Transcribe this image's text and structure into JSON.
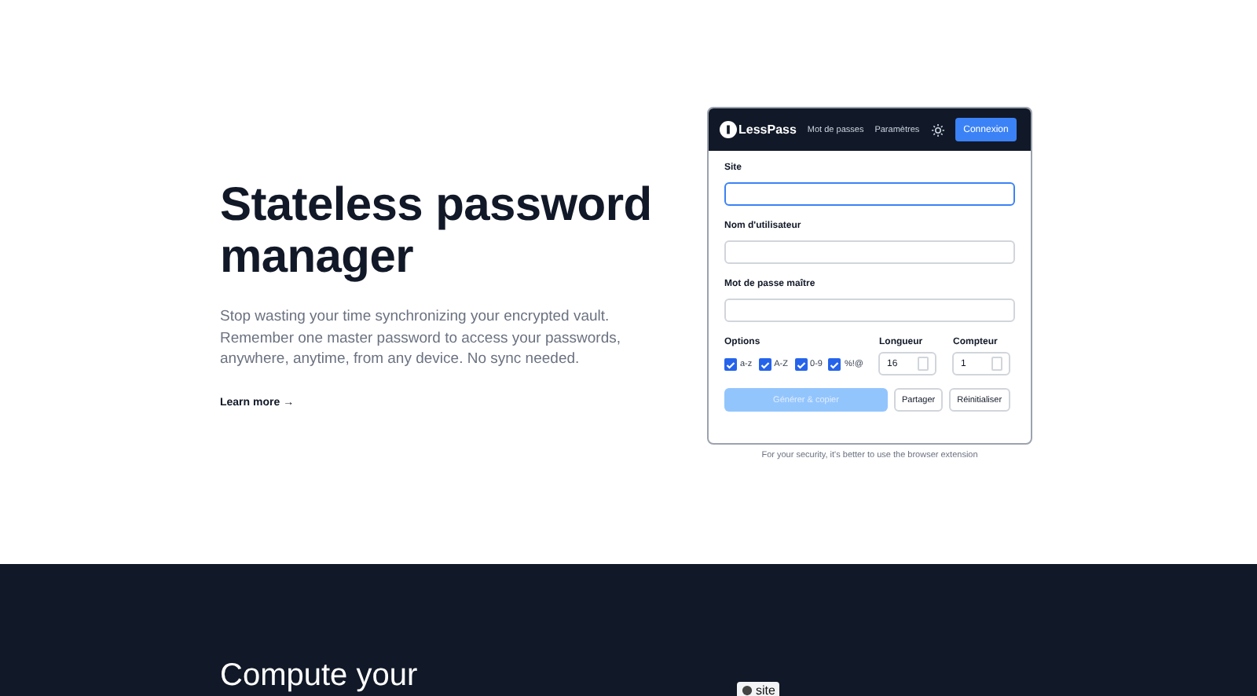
{
  "hero": {
    "title": "Stateless password manager",
    "description": "Stop wasting your time synchronizing your encrypted vault. Remember one master password to access your passwords, anywhere, anytime, from any device. No sync needed.",
    "link": "Learn more →"
  },
  "app": {
    "brand": "LessPass",
    "nav": [
      "Mot de passes",
      "Paramètres"
    ],
    "login": "Connexion",
    "fields": [
      {
        "label": "Site",
        "focused": true
      },
      {
        "label": "Nom d'utilisateur",
        "focused": false
      },
      {
        "label": "Mot de passe maître",
        "focused": false
      }
    ],
    "options_label": "Options",
    "options": [
      {
        "label": "a-z",
        "checked": true
      },
      {
        "label": "A-Z",
        "checked": true
      },
      {
        "label": "0-9",
        "checked": true
      },
      {
        "label": "%!@",
        "checked": true
      }
    ],
    "length": {
      "label": "Longueur",
      "value": "16"
    },
    "counter": {
      "label": "Compteur",
      "value": "1"
    },
    "generate": {
      "label": "Générer & copier",
      "disabled": true
    },
    "share": "Partager",
    "reset": "Réinitialiser"
  },
  "caption": "For your security, it's better to use the browser extension",
  "section2": {
    "title": "Compute your",
    "chip": "site"
  }
}
